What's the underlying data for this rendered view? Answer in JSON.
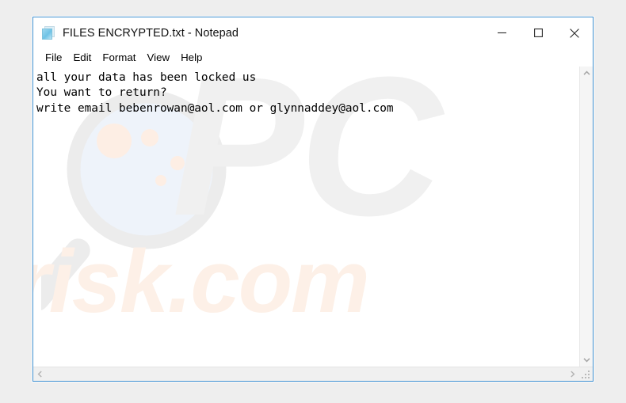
{
  "window": {
    "title": "FILES ENCRYPTED.txt - Notepad",
    "icon": "notepad-document-icon",
    "border_color": "#3e8fd0",
    "background": "#ffffff",
    "page_background": "#eeeeee"
  },
  "controls": {
    "minimize": "minimize-button",
    "maximize": "maximize-button",
    "close": "close-button"
  },
  "menu": {
    "items": [
      {
        "label": "File"
      },
      {
        "label": "Edit"
      },
      {
        "label": "Format"
      },
      {
        "label": "View"
      },
      {
        "label": "Help"
      }
    ]
  },
  "document": {
    "lines": [
      "all your data has been locked us",
      "You want to return?",
      "write email bebenrowan@aol.com or glynnaddey@aol.com"
    ],
    "text": "all your data has been locked us\nYou want to return?\nwrite email bebenrowan@aol.com or glynnaddey@aol.com",
    "emails": [
      "bebenrowan@aol.com",
      "glynnaddey@aol.com"
    ]
  },
  "watermark": {
    "brand_primary": "PC",
    "brand_secondary": "risk.com",
    "primary_color": "#f0f0f0",
    "secondary_color": "#fdf0e7",
    "magnifier": "magnifying-glass-icon"
  },
  "scrollbars": {
    "vertical_up": "scroll-up-arrow",
    "vertical_down": "scroll-down-arrow",
    "horizontal_left": "scroll-left-arrow",
    "horizontal_right": "scroll-right-arrow",
    "resize_grip": "resize-grip"
  }
}
